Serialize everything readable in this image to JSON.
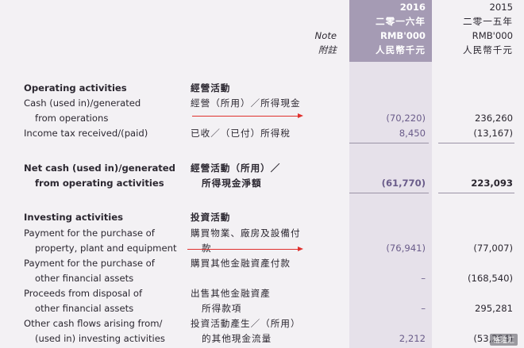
{
  "header": {
    "note_en": "Note",
    "note_zh": "附註",
    "y2016": {
      "year": "2016",
      "year_zh": "二零一六年",
      "unit": "RMB'000",
      "unit_zh": "人民幣千元"
    },
    "y2015": {
      "year": "2015",
      "year_zh": "二零一五年",
      "unit": "RMB'000",
      "unit_zh": "人民幣千元"
    }
  },
  "operating": {
    "title_en": "Operating activities",
    "title_zh": "經營活動",
    "cash_ops": {
      "en1": "Cash (used in)/generated",
      "en2": "from operations",
      "zh": "經營（所用）／所得現金",
      "v2016": "(70,220)",
      "v2015": "236,260"
    },
    "tax": {
      "en": "Income tax received/(paid)",
      "zh": "已收／（已付）所得稅",
      "v2016": "8,450",
      "v2015": "(13,167)"
    }
  },
  "net_operating": {
    "en1": "Net cash (used in)/generated",
    "en2": "from operating activities",
    "zh1": "經營活動（所用）／",
    "zh2": "所得現金淨額",
    "v2016": "(61,770)",
    "v2015": "223,093"
  },
  "investing": {
    "title_en": "Investing activities",
    "title_zh": "投資活動",
    "ppe": {
      "en1": "Payment for the purchase of",
      "en2": "property, plant and equipment",
      "zh1": "購買物業、廠房及設備付",
      "zh2": "款",
      "v2016": "(76,941)",
      "v2015": "(77,007)"
    },
    "ofa_purchase": {
      "en1": "Payment for the purchase of",
      "en2": "other financial assets",
      "zh": "購買其他金融資產付款",
      "v2016": "–",
      "v2015": "(168,540)"
    },
    "ofa_disposal": {
      "en1": "Proceeds from disposal of",
      "en2": "other financial assets",
      "zh1": "出售其他金融資產",
      "zh2": "所得款項",
      "v2016": "–",
      "v2015": "295,281"
    },
    "other_flows": {
      "en1": "Other cash flows arising from/",
      "en2": "(used in) investing activities",
      "zh1": "投資活動產生／（所用）",
      "zh2": "的其他現金流量",
      "v2016": "2,212",
      "v2015": "(53,294)"
    }
  },
  "watermark": "格隆汇",
  "colors": {
    "header_band": "#a59bb4",
    "annotation_arrow": "#e0302d",
    "value_2016": "#6a5c8a"
  }
}
